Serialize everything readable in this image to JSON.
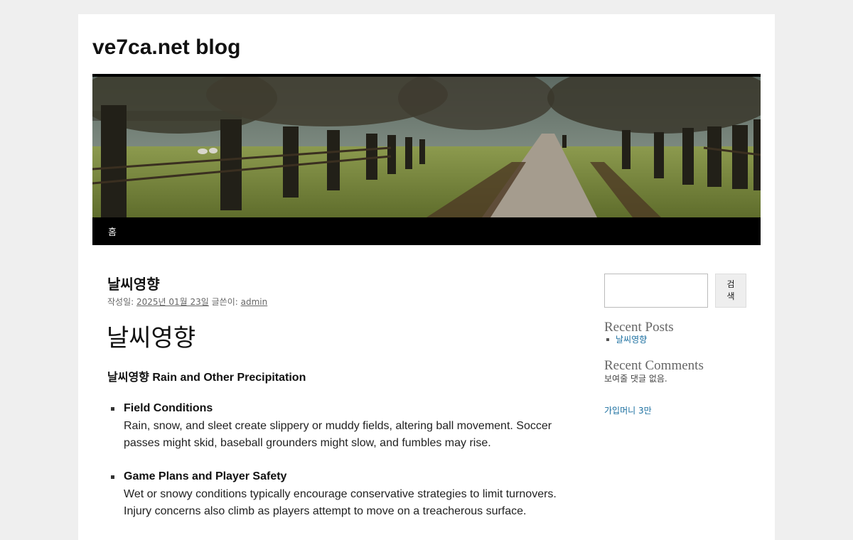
{
  "site": {
    "title": "ve7ca.net blog"
  },
  "nav": {
    "items": [
      {
        "label": "홈"
      }
    ]
  },
  "post": {
    "title": "날씨영향",
    "meta_prefix": "작성일: ",
    "date": "2025년 01월 23일",
    "author_prefix": " 글쓴이: ",
    "author": "admin",
    "heading": "날씨영향",
    "subheading": "날씨영향 Rain and Other Precipitation",
    "items": [
      {
        "title": "Field Conditions",
        "text": "Rain, snow, and sleet create slippery or muddy fields, altering ball movement. Soccer passes might skid, baseball grounders might slow, and fumbles may rise."
      },
      {
        "title": "Game Plans and Player Safety",
        "text": "Wet or snowy conditions typically encourage conservative strategies to limit turnovers. Injury concerns also climb as players attempt to move on a treacherous surface."
      }
    ]
  },
  "sidebar": {
    "search": {
      "value": "",
      "button_label": "검색"
    },
    "recent_posts": {
      "title": "Recent Posts",
      "items": [
        {
          "label": "날씨영향"
        }
      ]
    },
    "recent_comments": {
      "title": "Recent Comments",
      "empty_text": "보여줄 댓글 없음."
    },
    "extra_link": "가입머니 3만"
  },
  "colors": {
    "background": "#efefef",
    "link": "#1b6fa0",
    "nav_background": "#000000"
  }
}
